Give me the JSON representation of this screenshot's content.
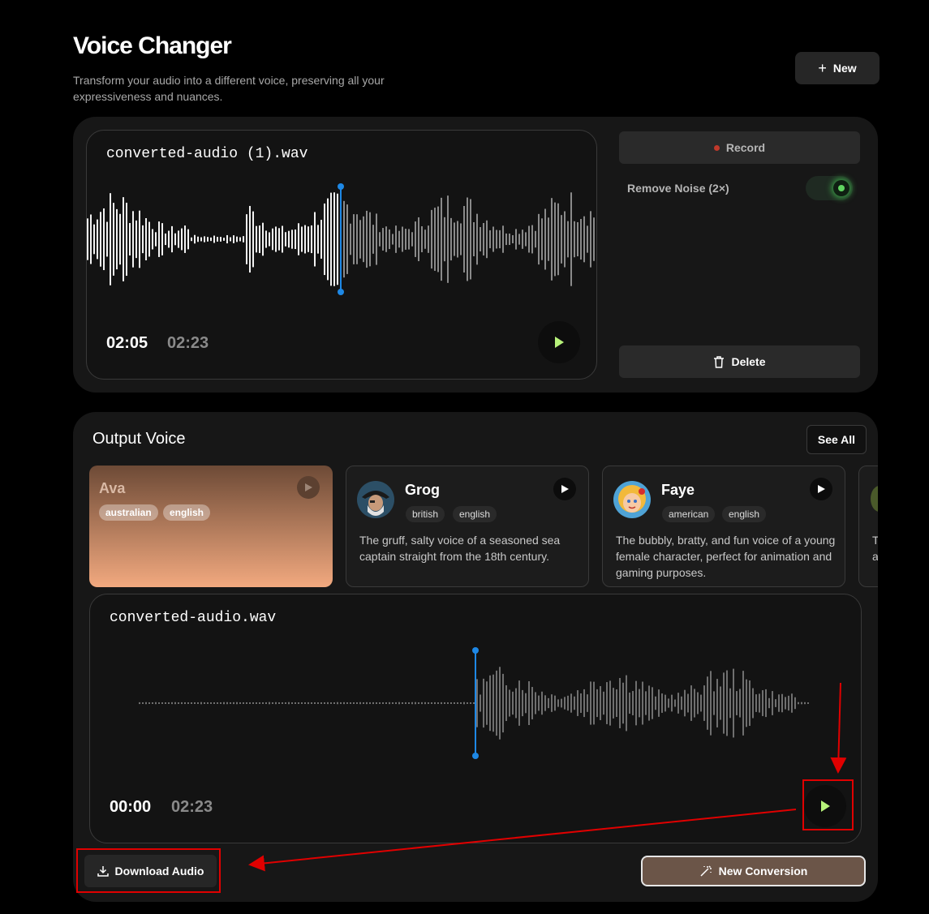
{
  "header": {
    "title": "Voice Changer",
    "subtitle": "Transform your audio into a different voice, preserving all your expressiveness and nuances.",
    "new_label": "New"
  },
  "input": {
    "filename": "converted-audio (1).wav",
    "current_time": "02:05",
    "duration": "02:23",
    "playhead_fraction": 0.5
  },
  "controls": {
    "record_label": "Record",
    "remove_noise_label": "Remove Noise (2×)",
    "remove_noise_on": true,
    "delete_label": "Delete"
  },
  "output": {
    "section_title": "Output Voice",
    "see_all_label": "See All",
    "voices": [
      {
        "name": "Ava",
        "tags": [
          "australian",
          "english"
        ],
        "description": "",
        "selected": true
      },
      {
        "name": "Grog",
        "tags": [
          "british",
          "english"
        ],
        "description": "The gruff, salty voice of a seasoned sea captain straight from the 18th century."
      },
      {
        "name": "Faye",
        "tags": [
          "american",
          "english"
        ],
        "description": "The bubbly, bratty, and fun voice of a young female character, perfect for animation and gaming purposes."
      },
      {
        "name": "",
        "tags": [],
        "description": "T a"
      }
    ],
    "filename": "converted-audio.wav",
    "current_time": "00:00",
    "duration": "02:23",
    "playhead_fraction": 0.0,
    "download_label": "Download Audio",
    "new_conversion_label": "New Conversion"
  },
  "colors": {
    "accent_blue": "#1e88e5",
    "play_green": "#b7f27a",
    "annotation_red": "#e00000",
    "ava_gradient_top": "#6d4a36",
    "ava_gradient_bottom": "#f2a97f"
  }
}
